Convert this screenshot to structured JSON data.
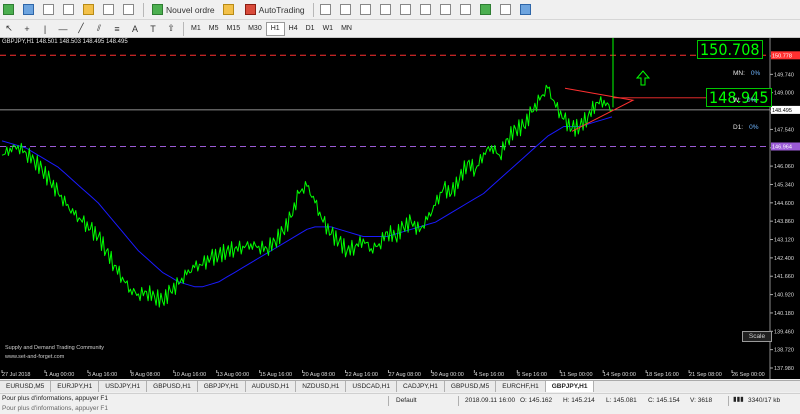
{
  "toolbar": {
    "new_order": "Nouvel ordre",
    "autotrading": "AutoTrading",
    "timeframes": [
      "M1",
      "M5",
      "M15",
      "M30",
      "H1",
      "H4",
      "D1",
      "W1",
      "MN"
    ]
  },
  "chart": {
    "title": "GBPJPY,H1  148.501 148.503 148.495 148.495",
    "price_box_top": "150.708",
    "price_box_mid": "148.945",
    "mn_label": "MN:",
    "mn_value": "0%",
    "w_label": "W:",
    "w_value": "0%",
    "d_label": "D1:",
    "d_value": "0%",
    "watermark_line1": "Supply and Demand Trading Community",
    "watermark_line2": "www.set-and-forget.com",
    "scale_button": "Scale",
    "red_line_label": "150.778",
    "current_price_label": "148.495",
    "purple_line_label": "146.964",
    "colors": {
      "price": "#00ff00",
      "ma": "#1a1aff",
      "red": "#ff3030",
      "purple": "#9b5bd6"
    }
  },
  "chart_data": {
    "type": "line",
    "series": [
      {
        "values": [
          146.6,
          146.9,
          147.0,
          146.7,
          146.4,
          146.0,
          145.5,
          145.0,
          144.5,
          144.1,
          143.8,
          143.5,
          143.2,
          142.6,
          142.0,
          141.5,
          141.0,
          140.8,
          140.9,
          140.7,
          140.5,
          140.9,
          141.2,
          141.6,
          141.9,
          142.0,
          142.3,
          142.4,
          142.6,
          142.7,
          142.8,
          142.9,
          142.8,
          142.7,
          143.0,
          143.4,
          144.0,
          145.0,
          145.3,
          144.6,
          143.8,
          143.3,
          143.0,
          142.6,
          142.8,
          143.1,
          142.7,
          142.9,
          143.4,
          143.2,
          143.6,
          143.8,
          143.4,
          143.9,
          144.5,
          145.2,
          145.0,
          145.6,
          146.3,
          146.0,
          146.7,
          147.0,
          146.6,
          147.3,
          147.7,
          147.8,
          148.4,
          148.9,
          149.4,
          148.6,
          148.1,
          147.7,
          147.8,
          148.2,
          148.8,
          148.9,
          148.5
        ]
      },
      {
        "values": [
          147.2,
          147.1,
          147.0,
          146.9,
          146.7,
          146.5,
          146.3,
          146.1,
          145.8,
          145.5,
          145.2,
          144.9,
          144.6,
          144.2,
          143.8,
          143.4,
          143.0,
          142.6,
          142.3,
          142.0,
          141.7,
          141.5,
          141.3,
          141.2,
          141.1,
          141.1,
          141.2,
          141.3,
          141.5,
          141.7,
          141.9,
          142.1,
          142.3,
          142.5,
          142.7,
          142.9,
          143.1,
          143.3,
          143.5,
          143.6,
          143.6,
          143.6,
          143.5,
          143.4,
          143.3,
          143.2,
          143.2,
          143.2,
          143.2,
          143.3,
          143.4,
          143.5,
          143.6,
          143.7,
          143.8,
          144.0,
          144.2,
          144.4,
          144.6,
          144.8,
          145.0,
          145.3,
          145.6,
          145.9,
          146.2,
          146.5,
          146.8,
          147.1,
          147.4,
          147.6,
          147.8,
          147.8,
          147.8,
          147.9,
          148.0,
          148.1,
          148.2
        ]
      }
    ],
    "y_ticks": [
      "150.480",
      "149.740",
      "149.000",
      "148.260",
      "147.540",
      "146.800",
      "146.060",
      "145.340",
      "144.600",
      "143.860",
      "143.120",
      "142.400",
      "141.660",
      "140.920",
      "140.180",
      "139.460",
      "138.720",
      "137.980"
    ],
    "x_ticks": [
      "27 Jul 2018",
      "1 Aug 00:00",
      "3 Aug 16:00",
      "8 Aug 08:00",
      "10 Aug 16:00",
      "13 Aug 00:00",
      "15 Aug 16:00",
      "20 Aug 08:00",
      "22 Aug 16:00",
      "27 Aug 08:00",
      "30 Aug 00:00",
      "4 Sep 16:00",
      "6 Sep 16:00",
      "11 Sep 00:00",
      "14 Sep 00:00",
      "18 Sep 16:00",
      "21 Sep 08:00",
      "26 Sep 00:00"
    ],
    "ylim": [
      137.7,
      151.0
    ]
  },
  "tabs": [
    "EURUSD,M5",
    "EURJPY,H1",
    "USDJPY,H1",
    "GBPUSD,H1",
    "GBPJPY,H1",
    "AUDUSD,H1",
    "NZDUSD,H1",
    "USDCAD,H1",
    "CADJPY,H1",
    "GBPUSD,M5",
    "EURCHF,H1",
    "GBPJPY,H1"
  ],
  "status": {
    "help_line1": "Pour plus d'informations, appuyer F1",
    "help_line2": "Pour plus d'informations, appuyer F1",
    "profile": "Default",
    "datetime": "2018.09.11 16:00",
    "open": "O: 145.162",
    "high": "H: 145.214",
    "low": "L: 145.081",
    "close": "C: 145.154",
    "volume": "V: 3618",
    "traffic": "3340/17 kb"
  }
}
